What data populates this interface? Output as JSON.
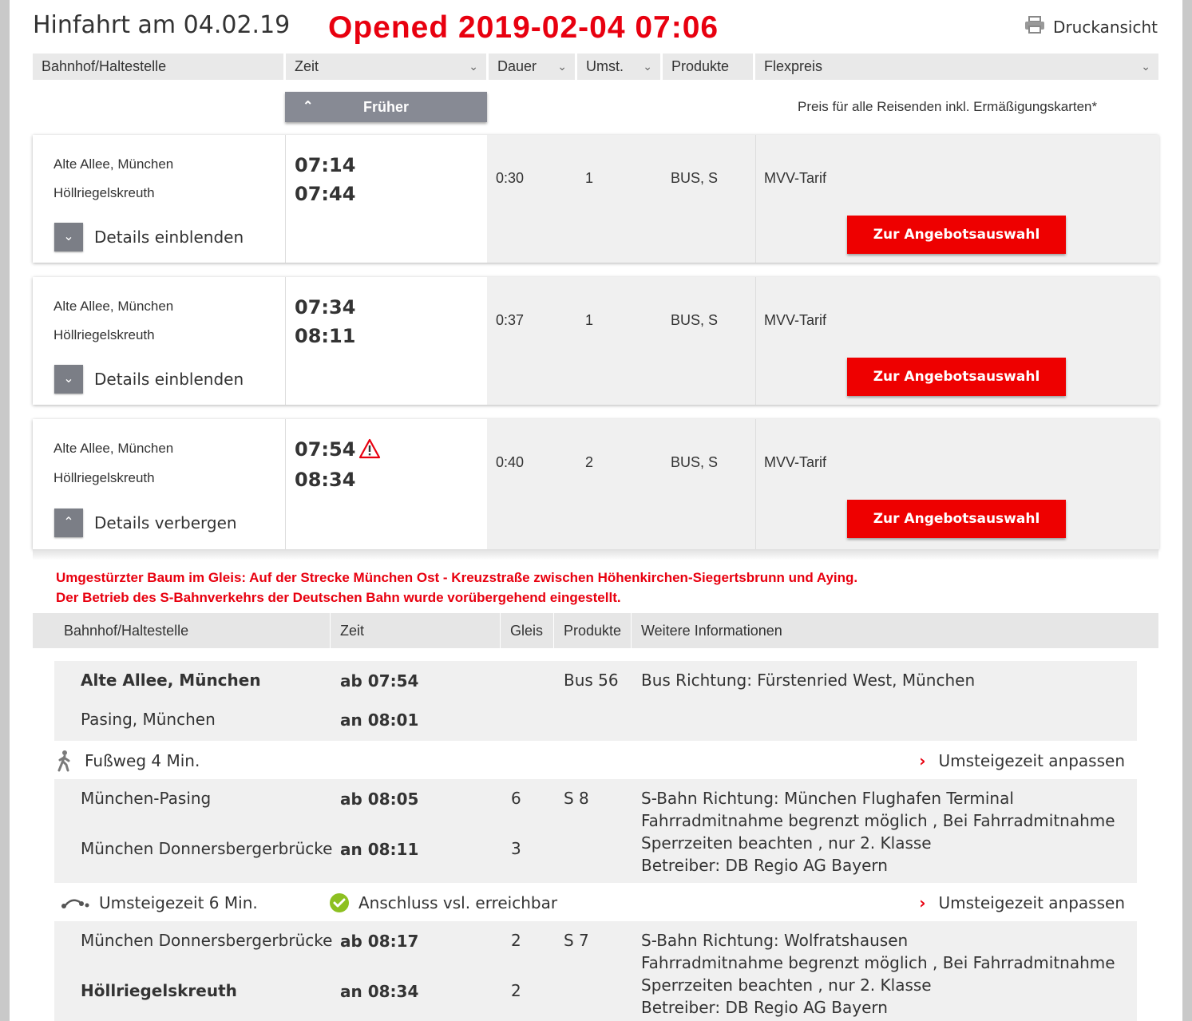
{
  "header": {
    "title": "Hinfahrt am 04.02.19",
    "stamp": "Opened 2019-02-04 07:06",
    "print_label": "Druckansicht"
  },
  "columns": {
    "station": "Bahnhof/Haltestelle",
    "time": "Zeit",
    "duration": "Dauer",
    "changes": "Umst.",
    "products": "Produkte",
    "fare": "Flexpreis"
  },
  "earlier_label": "Früher",
  "price_note": "Preis für alle Reisenden inkl. Ermäßigungskarten*",
  "offer_label": "Zur Angebotsauswahl",
  "connections": [
    {
      "from": "Alte Allee, München",
      "to": "Höllriegelskreuth",
      "dep": "07:14",
      "arr": "07:44",
      "duration": "0:30",
      "changes": "1",
      "products": "BUS, S",
      "tariff": "MVV-Tarif",
      "toggle": "Details einblenden",
      "warning": false
    },
    {
      "from": "Alte Allee, München",
      "to": "Höllriegelskreuth",
      "dep": "07:34",
      "arr": "08:11",
      "duration": "0:37",
      "changes": "1",
      "products": "BUS, S",
      "tariff": "MVV-Tarif",
      "toggle": "Details einblenden",
      "warning": false
    },
    {
      "from": "Alte Allee, München",
      "to": "Höllriegelskreuth",
      "dep": "07:54",
      "arr": "08:34",
      "duration": "0:40",
      "changes": "2",
      "products": "BUS, S",
      "tariff": "MVV-Tarif",
      "toggle": "Details verbergen",
      "warning": true
    }
  ],
  "details": {
    "alert_line1": "Umgestürzter Baum im Gleis: Auf der Strecke München Ost - Kreuzstraße zwischen Höhenkirchen-Siegertsbrunn und Aying.",
    "alert_line2": "Der Betrieb des S-Bahnverkehrs der Deutschen Bahn wurde vorübergehend eingestellt.",
    "columns": {
      "station": "Bahnhof/Haltestelle",
      "time": "Zeit",
      "platform": "Gleis",
      "products": "Produkte",
      "info": "Weitere Informationen"
    },
    "segments": [
      {
        "from": "Alte Allee, München",
        "from_time": "ab 07:54",
        "from_platform": "",
        "to": "Pasing, München",
        "to_time": "an 08:01",
        "to_platform": "",
        "product": "Bus 56",
        "info": [
          "Bus Richtung: Fürstenried West, München"
        ]
      },
      {
        "from": "München-Pasing",
        "from_time": "ab 08:05",
        "from_platform": "6",
        "to": "München Donnersbergerbrücke",
        "to_time": "an 08:11",
        "to_platform": "3",
        "product": "S 8",
        "info": [
          "S-Bahn Richtung: München Flughafen Terminal",
          "Fahrradmitnahme begrenzt möglich , Bei Fahrradmitnahme",
          "Sperrzeiten beachten , nur 2. Klasse",
          "Betreiber: DB Regio AG Bayern"
        ]
      },
      {
        "from": "München Donnersbergerbrücke",
        "from_time": "ab 08:17",
        "from_platform": "2",
        "to": "Höllriegelskreuth",
        "to_time": "an 08:34",
        "to_platform": "2",
        "product": "S 7",
        "info": [
          "S-Bahn Richtung: Wolfratshausen",
          "Fahrradmitnahme begrenzt möglich , Bei Fahrradmitnahme",
          "Sperrzeiten beachten , nur 2. Klasse",
          "Betreiber: DB Regio AG Bayern"
        ]
      }
    ],
    "walk_label": "Fußweg 4 Min.",
    "transfer_label": "Umsteigezeit 6 Min.",
    "connection_status": "Anschluss vsl. erreichbar",
    "adjust_label": "Umsteigezeit anpassen"
  },
  "colors": {
    "accent_red": "#ee0000",
    "stamp_red": "#e8000f",
    "button_gray": "#878a94",
    "ok_green": "#8dc021"
  }
}
